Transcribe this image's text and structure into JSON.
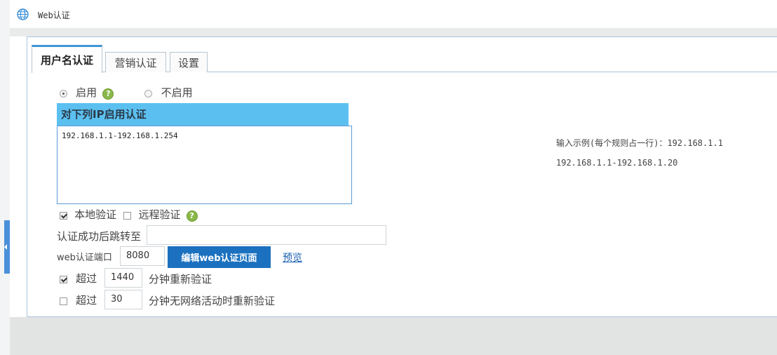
{
  "window": {
    "title": "Web认证"
  },
  "tabs": [
    {
      "label": "用户名认证",
      "active": true
    },
    {
      "label": "营销认证",
      "active": false
    },
    {
      "label": "设置",
      "active": false
    }
  ],
  "enable": {
    "on_label": "启用",
    "off_label": "不启用",
    "selected": "on",
    "help": "?"
  },
  "ip_section": {
    "header": "对下列IP启用认证",
    "value": "192.168.1.1-192.168.1.254"
  },
  "hint": {
    "line1": "输入示例(每个规则占一行)：192.168.1.1",
    "line2": "192.168.1.1-192.168.1.20"
  },
  "auth_mode": {
    "local_label": "本地验证",
    "local_checked": true,
    "remote_label": "远程验证",
    "remote_checked": false,
    "help": "?"
  },
  "redirect": {
    "label": "认证成功后跳转至",
    "value": ""
  },
  "port": {
    "label": "web认证端口",
    "value": "8080",
    "edit_button": "编辑web认证页面",
    "preview_link": "预览"
  },
  "reauth": {
    "checked": true,
    "prefix": "超过",
    "value": "1440",
    "suffix": "分钟重新验证"
  },
  "idle_reauth": {
    "checked": false,
    "prefix": "超过",
    "value": "30",
    "suffix": "分钟无网络活动时重新验证"
  },
  "colors": {
    "accent": "#1b71bf",
    "header": "#5bc0f0",
    "tab_active": "#3f95d6"
  }
}
